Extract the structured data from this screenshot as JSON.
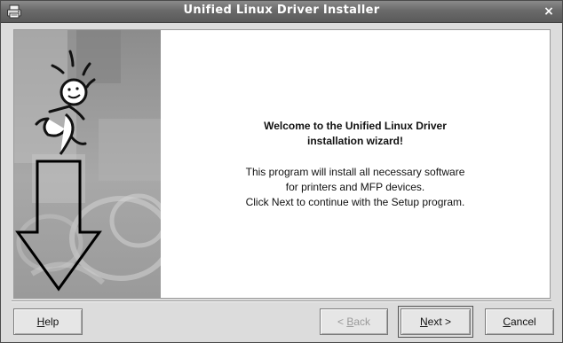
{
  "window": {
    "title": "Unified Linux Driver Installer",
    "close_glyph": "×",
    "app_icon": "printer-icon"
  },
  "side_image": {
    "description_icon": "installer-mascot-arrow-illustration"
  },
  "welcome": {
    "title_line1": "Welcome to the Unified Linux Driver",
    "title_line2": "installation wizard!",
    "body_line1": "This program will install all necessary software",
    "body_line2": "for printers and MFP devices.",
    "body_line3": "Click Next to continue with the Setup program."
  },
  "buttons": {
    "help": {
      "mnemonic": "H",
      "rest": "elp"
    },
    "back": {
      "prefix": "< ",
      "mnemonic": "B",
      "rest": "ack",
      "enabled": false
    },
    "next": {
      "mnemonic": "N",
      "rest": "ext >"
    },
    "cancel": {
      "mnemonic": "C",
      "rest": "ancel"
    }
  }
}
